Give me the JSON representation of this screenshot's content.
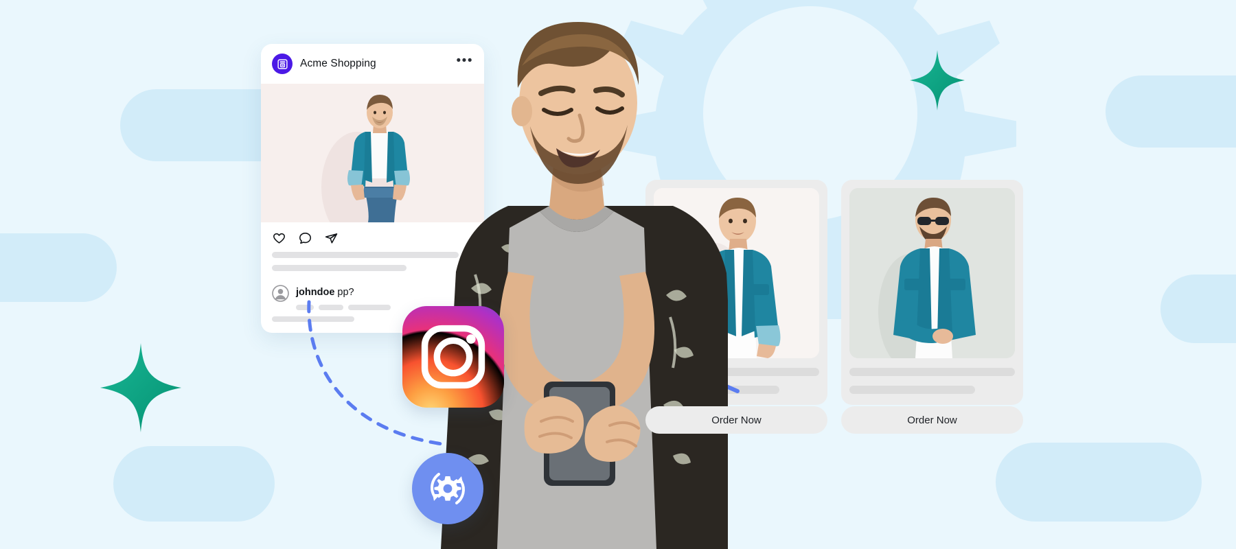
{
  "palette": {
    "background": "#eaf7fd",
    "cloud": "#d2ecf9",
    "gear_silhouette": "#d4edfa",
    "sparkle_from": "#0ea882",
    "sparkle_to": "#18b392",
    "store_avatar_bg": "#4b19e6",
    "card_gray": "#ececec",
    "skeleton_gray": "#e2e2e4",
    "arrow_blue": "#5b7cf0",
    "sync_badge_bg": "#6f8ff0",
    "denim_teal": "#1f87a0",
    "text_dark": "#111418"
  },
  "post": {
    "store_name": "Acme Shopping",
    "store_avatar_icon": "storefront-icon",
    "more_menu_label": "•••",
    "more_menu_icon": "ellipsis-icon",
    "actions": [
      {
        "name": "like-icon",
        "label": "Like"
      },
      {
        "name": "comment-icon",
        "label": "Comment"
      },
      {
        "name": "share-icon",
        "label": "Share"
      }
    ],
    "photo_alt": "Man in teal denim shirt and white tee",
    "comment": {
      "avatar_icon": "user-avatar-icon",
      "username": "johndoe",
      "message": "pp?"
    }
  },
  "products": [
    {
      "name": "product-card-1",
      "photo_alt": "Model wearing teal denim shirt",
      "order_button_label": "Order Now"
    },
    {
      "name": "product-card-2",
      "photo_alt": "Model wearing teal denim jacket and sunglasses",
      "order_button_label": "Order Now"
    }
  ],
  "badges": {
    "instagram": {
      "icon": "instagram-logo-icon",
      "label": "Instagram"
    },
    "automation": {
      "icon": "gear-sync-icon",
      "label": "Automation sync"
    }
  },
  "hero": {
    "alt": "Smiling man in floral shirt looking at his phone"
  },
  "decor": {
    "sparkles": [
      {
        "name": "sparkle-star-left"
      },
      {
        "name": "sparkle-star-right"
      }
    ],
    "gear_background": {
      "name": "gear-background-shape"
    },
    "arrow": {
      "name": "dashed-flow-arrow"
    }
  }
}
